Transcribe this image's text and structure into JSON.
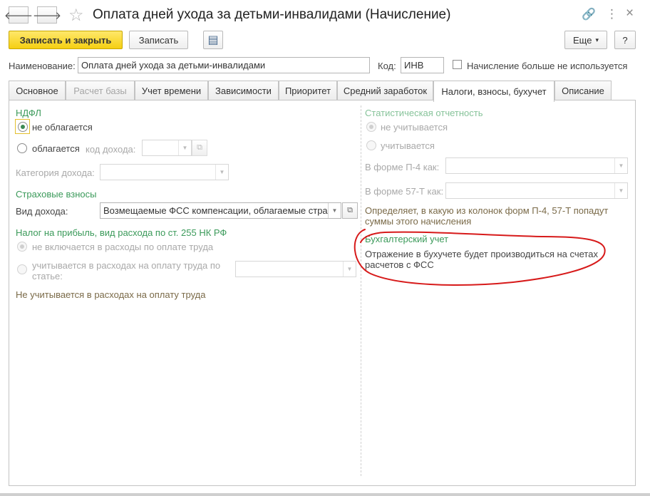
{
  "window": {
    "title": "Оплата дней ухода за детьми-инвалидами (Начисление)",
    "icons": [
      "back-arrow-icon",
      "forward-arrow-icon",
      "star-icon",
      "link-icon",
      "menu-dots-icon",
      "close-icon"
    ],
    "back_glyph": "🡐",
    "forward_glyph": "🡒",
    "star_glyph": "☆",
    "link_glyph": "🔗",
    "more_glyph": "⋮",
    "close_glyph": "×"
  },
  "toolbar": {
    "save_close_label": "Записать и закрыть",
    "save_label": "Записать",
    "report_glyph": "▤",
    "more_label": "Еще",
    "more_arrow": "▾",
    "help_label": "?"
  },
  "header": {
    "name_label": "Наименование:",
    "name_value": "Оплата дней ухода за детьми-инвалидами",
    "code_label": "Код:",
    "code_value": "ИНВ",
    "unused_label": "Начисление больше не используется"
  },
  "tabs": [
    {
      "label": "Основное",
      "disabled": false
    },
    {
      "label": "Расчет базы",
      "disabled": true
    },
    {
      "label": "Учет времени",
      "disabled": false
    },
    {
      "label": "Зависимости",
      "disabled": false
    },
    {
      "label": "Приоритет",
      "disabled": false
    },
    {
      "label": "Средний заработок",
      "disabled": false
    },
    {
      "label": "Налоги, взносы, бухучет",
      "disabled": false,
      "active": true
    },
    {
      "label": "Описание",
      "disabled": false
    }
  ],
  "left": {
    "ndfl_title": "НДФЛ",
    "ndfl_not_taxed": "не облагается",
    "ndfl_taxed": "облагается",
    "income_code_label": "код дохода:",
    "income_category_label": "Категория дохода:",
    "insurance_title": "Страховые взносы",
    "income_type_label": "Вид дохода:",
    "income_type_value": "Возмещаемые ФСС компенсации, облагаемые стра",
    "profit_tax_title": "Налог на прибыль, вид расхода по ст. 255 НК РФ",
    "not_included": "не включается в расходы по оплате труда",
    "included_line1": "учитывается в расходах на оплату труда по",
    "included_line2": "статье:",
    "not_counted_note": "Не учитывается в расходах на оплату труда"
  },
  "right": {
    "stat_title": "Статистическая отчетность",
    "not_counted": "не учитывается",
    "counted": "учитывается",
    "p4_label": "В форме П-4 как:",
    "t57_label": "В форме 57-Т как:",
    "note_line1": "Определяет, в какую из колонок форм П-4, 57-Т попадут",
    "note_line2": "суммы этого начисления",
    "accounting_title": "Бухгалтерский учет",
    "accounting_line1": "Отражение в бухучете будет производиться на счетах",
    "accounting_line2": "расчетов с ФСС"
  },
  "glyphs": {
    "dropdown": "▼",
    "open": "⧉"
  },
  "colors": {
    "accent_green": "#3b9a5a",
    "primary_button": "#f5cf12",
    "annotation": "#d71a1a"
  }
}
